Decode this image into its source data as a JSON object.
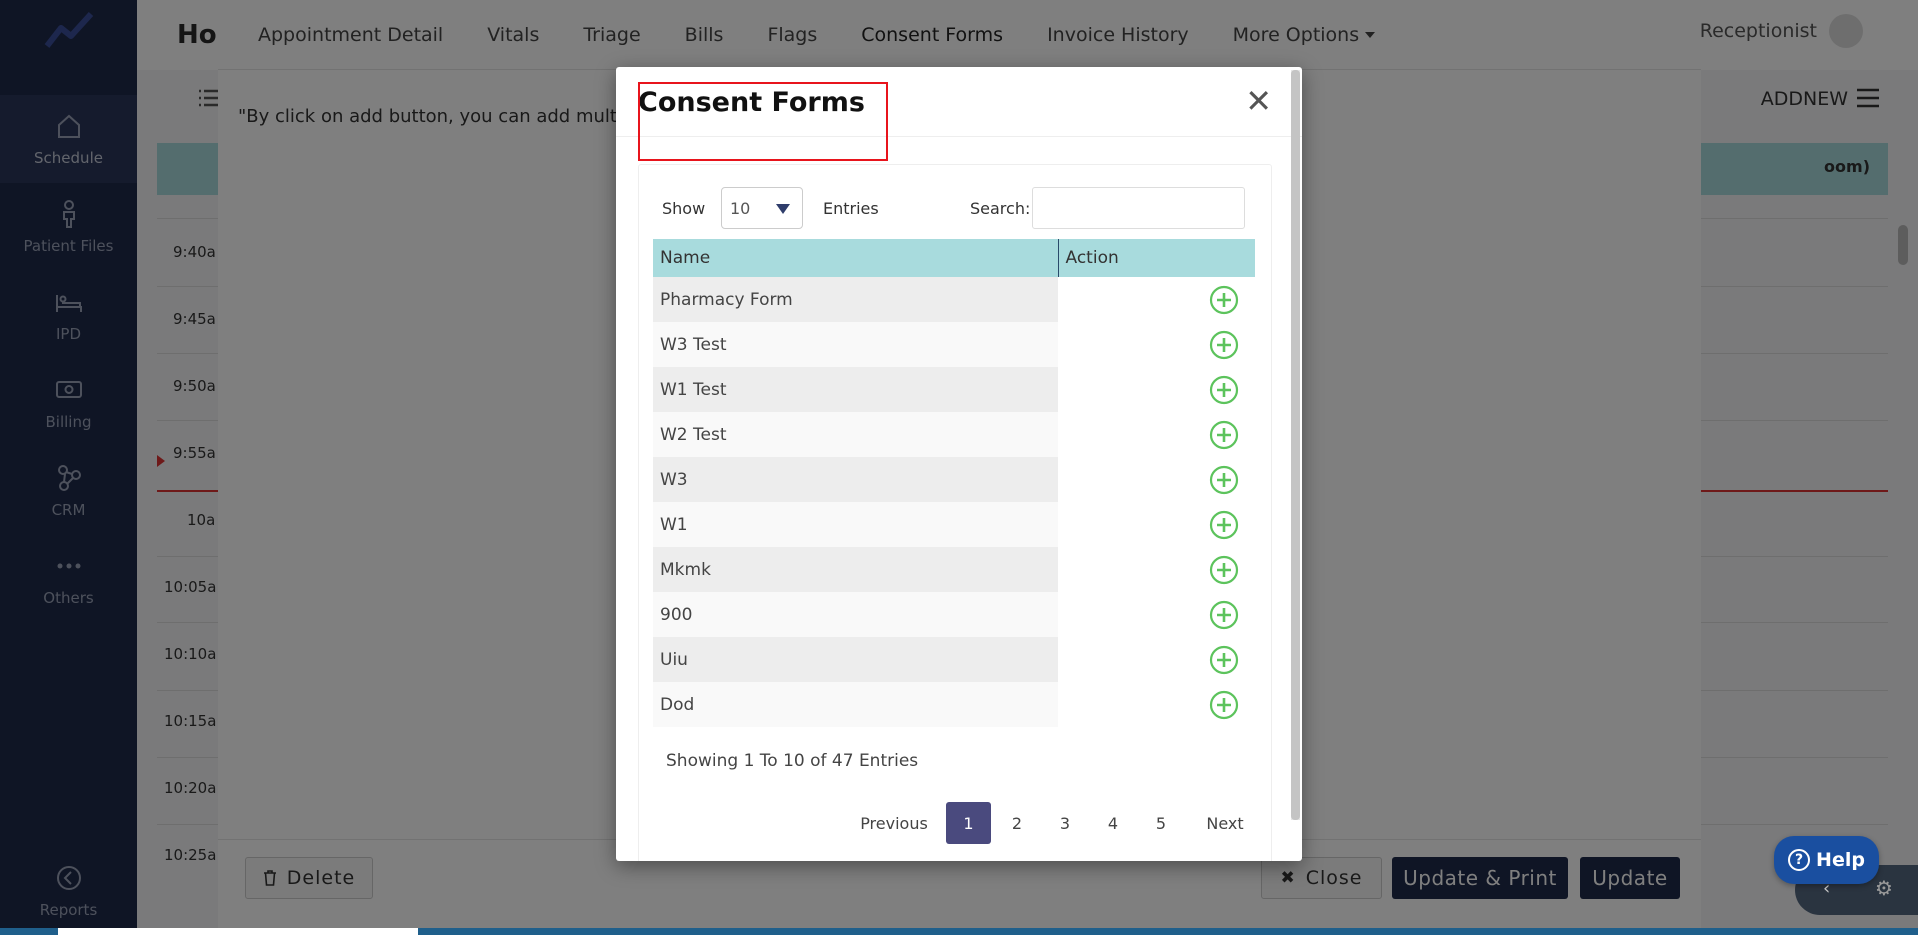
{
  "sidebar": {
    "items": [
      {
        "label": "Schedule"
      },
      {
        "label": "Patient Files"
      },
      {
        "label": "IPD"
      },
      {
        "label": "Billing"
      },
      {
        "label": "CRM"
      },
      {
        "label": "Others"
      }
    ],
    "bottom": {
      "label": "Reports"
    }
  },
  "app": {
    "title": "Ho",
    "user_role": "Receptionist",
    "addnew_label": "ADDNEW",
    "column_header_fragment": "oom)",
    "time_slots": [
      "9:40a",
      "9:45a",
      "9:50a",
      "9:55a",
      "10a",
      "10:05a",
      "10:10a",
      "10:15a",
      "10:20a",
      "10:25a"
    ]
  },
  "panel": {
    "tabs": [
      {
        "label": "Appointment Detail"
      },
      {
        "label": "Vitals"
      },
      {
        "label": "Triage"
      },
      {
        "label": "Bills"
      },
      {
        "label": "Flags"
      },
      {
        "label": "Consent Forms"
      },
      {
        "label": "Invoice History"
      },
      {
        "label": "More Options"
      }
    ],
    "note": "\"By click on add button, you can add multipl",
    "footer": {
      "delete_label": "Delete",
      "close_label": "Close",
      "update_print_label": "Update & Print",
      "update_label": "Update"
    }
  },
  "modal": {
    "title": "Consent Forms",
    "close_glyph": "✕",
    "controls": {
      "show_label": "Show",
      "entries_value": "10",
      "entries_label": "Entries",
      "search_label": "Search:",
      "search_value": ""
    },
    "table": {
      "headers": [
        "Name",
        "Action"
      ],
      "rows": [
        {
          "name": "Pharmacy Form"
        },
        {
          "name": "W3 Test"
        },
        {
          "name": "W1 Test"
        },
        {
          "name": "W2 Test"
        },
        {
          "name": "W3"
        },
        {
          "name": "W1"
        },
        {
          "name": "Mkmk"
        },
        {
          "name": "900"
        },
        {
          "name": "Uiu"
        },
        {
          "name": "Dod"
        }
      ]
    },
    "showing_text": "Showing 1 To 10 of 47 Entries",
    "pagination": {
      "previous": "Previous",
      "pages": [
        "1",
        "2",
        "3",
        "4",
        "5"
      ],
      "current": "1",
      "next": "Next"
    }
  },
  "help": {
    "label": "Help",
    "glyph": "?"
  },
  "colors": {
    "sidebar_bg": "#1f2a4a",
    "table_header_bg": "#a8dbdd",
    "add_icon_green": "#5cc35c",
    "highlight_red": "#e8141c",
    "pager_active": "#4a4a7e",
    "help_blue": "#1a4fa0"
  }
}
